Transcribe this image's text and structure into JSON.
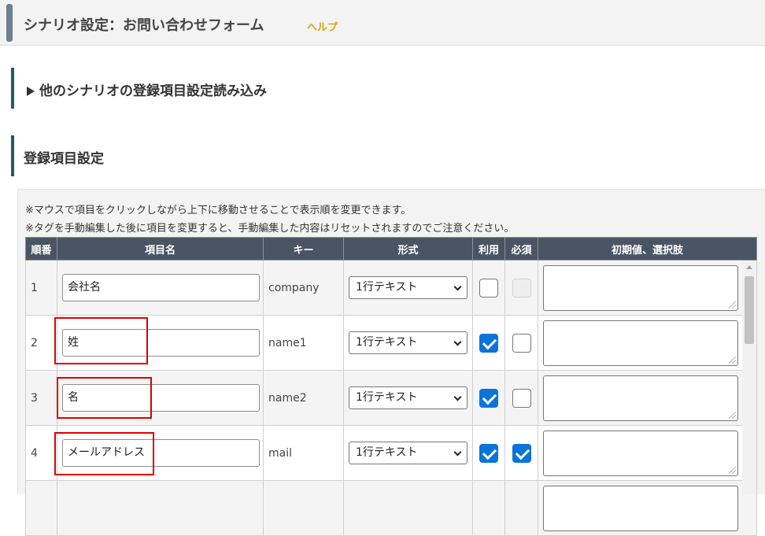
{
  "header": {
    "title": "シナリオ設定：お問い合わせフォーム",
    "help": "ヘルプ"
  },
  "sections": {
    "import": "他のシナリオの登録項目設定読み込み",
    "items": "登録項目設定"
  },
  "notes": [
    "※マウスで項目をクリックしながら上下に移動させることで表示順を変更できます。",
    "※タグを手動編集した後に項目を変更すると、手動編集した内容はリセットされますのでご注意ください。"
  ],
  "table": {
    "columns": [
      "順番",
      "項目名",
      "キー",
      "形式",
      "利用",
      "必須",
      "初期値、選択肢"
    ],
    "rows": [
      {
        "order": "1",
        "name": "会社名",
        "key": "company",
        "format": "1行テキスト",
        "use": false,
        "required": false,
        "required_disabled": true,
        "highlighted": false
      },
      {
        "order": "2",
        "name": "姓",
        "key": "name1",
        "format": "1行テキスト",
        "use": true,
        "required": false,
        "required_disabled": false,
        "highlighted": true
      },
      {
        "order": "3",
        "name": "名",
        "key": "name2",
        "format": "1行テキスト",
        "use": true,
        "required": false,
        "required_disabled": false,
        "highlighted": true
      },
      {
        "order": "4",
        "name": "メールアドレス",
        "key": "mail",
        "format": "1行テキスト",
        "use": true,
        "required": true,
        "required_disabled": false,
        "highlighted": true
      }
    ]
  },
  "colors": {
    "header_accent": "#6d7f91",
    "section_bar": "#1f5c68",
    "table_header": "#4a5563",
    "checkbox": "#0b74d8",
    "help": "#d9a300",
    "highlight": "#e00000"
  }
}
